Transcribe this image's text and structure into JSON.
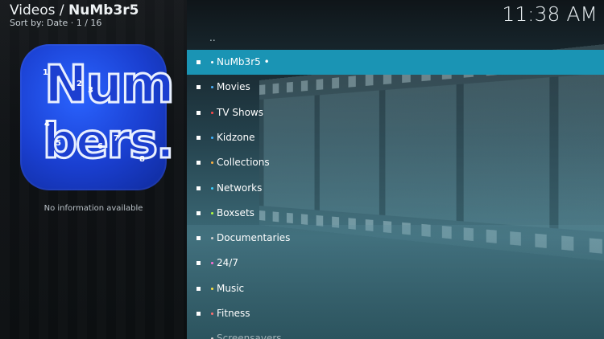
{
  "header": {
    "section": "Videos",
    "separator": " / ",
    "addon": "NuMb3r5",
    "sort_info": "Sort by: Date  ·  1 / 16"
  },
  "clock": "11:38 AM",
  "logo": {
    "word_top": "Num",
    "word_bottom": "bers.",
    "digits": [
      "1",
      "2",
      "3",
      "4",
      "5",
      "6",
      "7",
      "8"
    ]
  },
  "info": {
    "no_info": "No information available"
  },
  "list": {
    "parent": "..",
    "items": [
      {
        "label": "NuMb3r5 •",
        "dot": "#ffffff",
        "selected": true
      },
      {
        "label": "Movies",
        "dot": "#4fb3ff"
      },
      {
        "label": "TV Shows",
        "dot": "#ff4a4a"
      },
      {
        "label": "Kidzone",
        "dot": "#3fb3ff"
      },
      {
        "label": "Collections",
        "dot": "#ffb33f"
      },
      {
        "label": "Networks",
        "dot": "#3fd0ff"
      },
      {
        "label": "Boxsets",
        "dot": "#b4ff3f"
      },
      {
        "label": "Documentaries",
        "dot": "#cfcfcf"
      },
      {
        "label": "24/7",
        "dot": "#ff6fd8"
      },
      {
        "label": "Music",
        "dot": "#ffe13f"
      },
      {
        "label": "Fitness",
        "dot": "#ff6f6f"
      },
      {
        "label": "Screensavers",
        "dot": "#cfcfcf"
      }
    ]
  }
}
